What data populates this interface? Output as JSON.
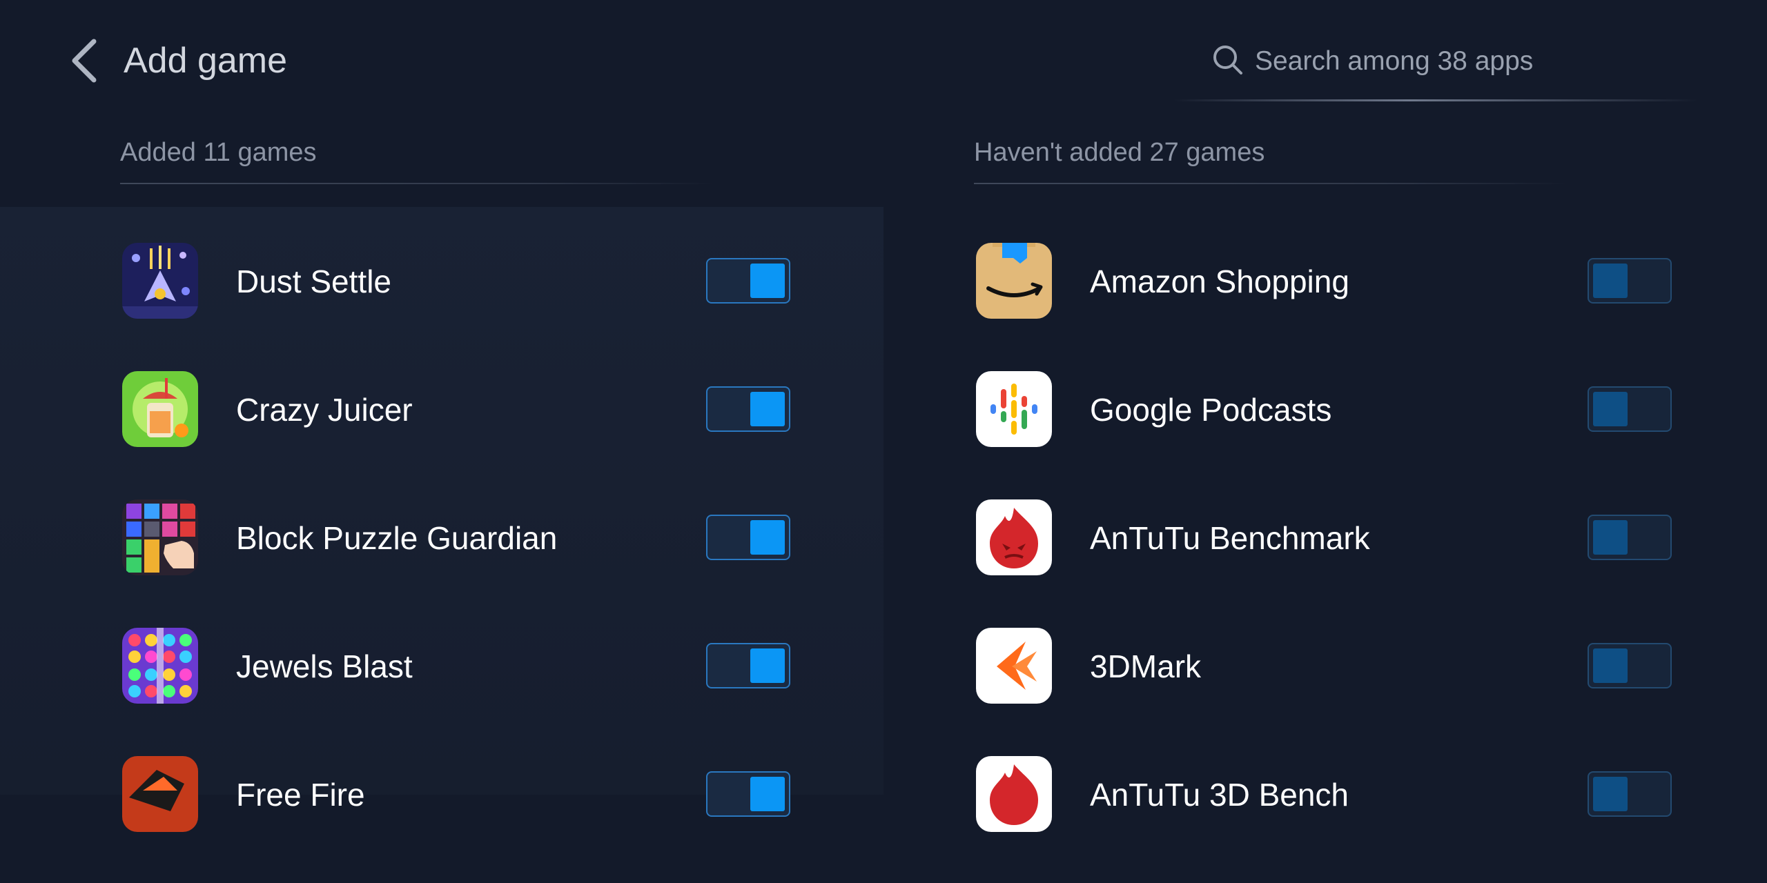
{
  "header": {
    "title": "Add game",
    "search_placeholder": "Search among 38 apps"
  },
  "added": {
    "header": "Added 11 games",
    "items": [
      {
        "name": "Dust Settle",
        "enabled": true
      },
      {
        "name": "Crazy Juicer",
        "enabled": true
      },
      {
        "name": "Block Puzzle Guardian",
        "enabled": true
      },
      {
        "name": "Jewels Blast",
        "enabled": true
      },
      {
        "name": "Free Fire",
        "enabled": true
      }
    ]
  },
  "not_added": {
    "header": "Haven't added 27 games",
    "items": [
      {
        "name": "Amazon Shopping",
        "enabled": false
      },
      {
        "name": "Google Podcasts",
        "enabled": false
      },
      {
        "name": "AnTuTu Benchmark",
        "enabled": false
      },
      {
        "name": "3DMark",
        "enabled": false
      },
      {
        "name": "AnTuTu 3D Bench",
        "enabled": false
      }
    ]
  },
  "colors": {
    "background": "#131a2a",
    "toggle_on": "#0b96f5",
    "toggle_off": "#0e4f85"
  }
}
